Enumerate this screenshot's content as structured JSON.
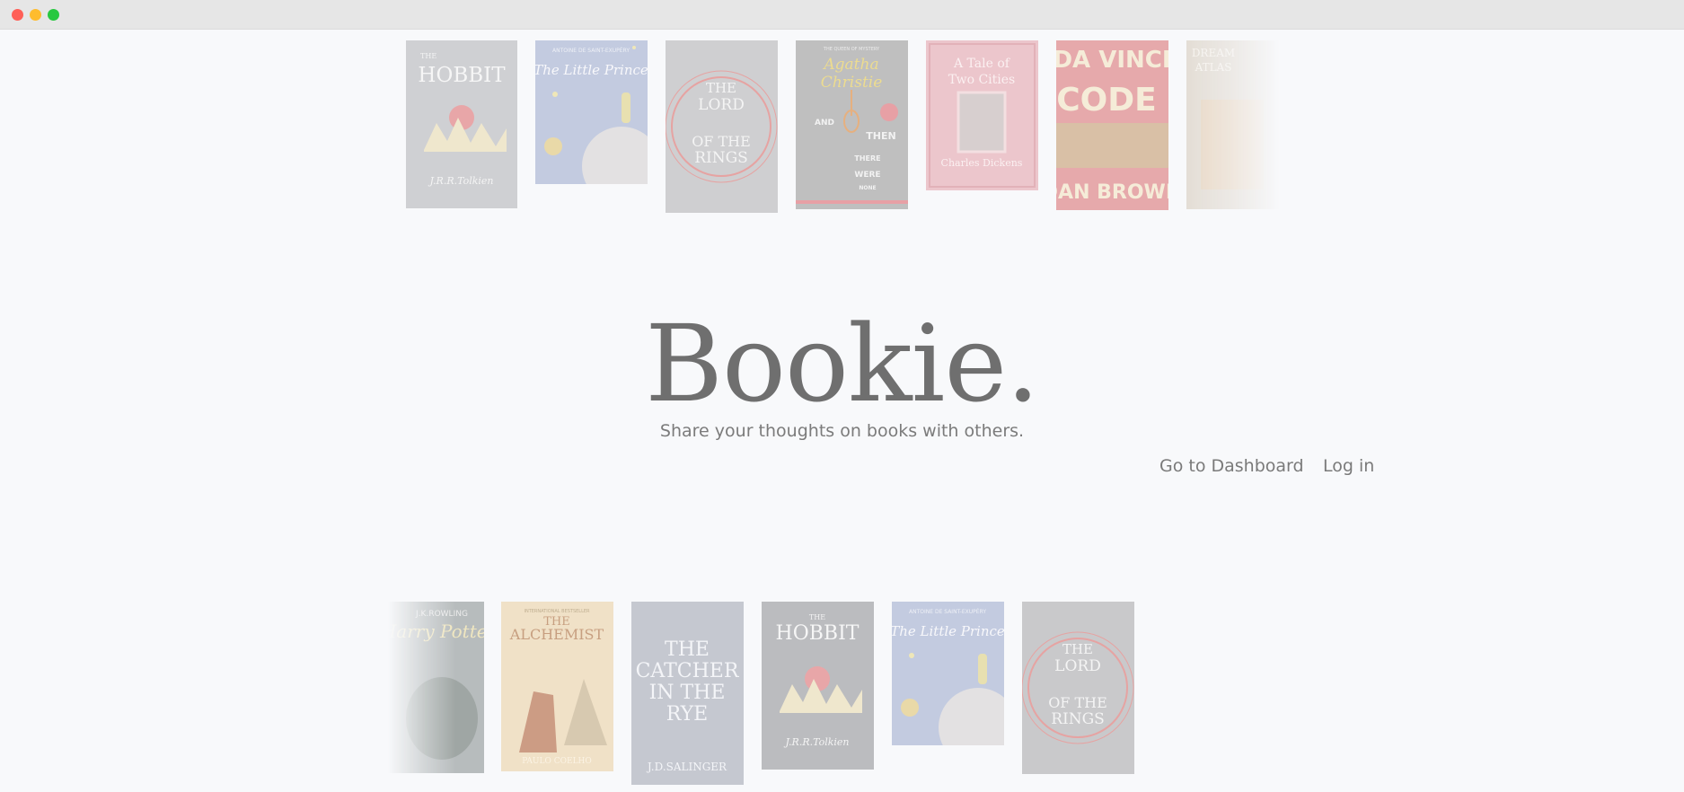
{
  "window": {
    "controls": [
      "close",
      "minimize",
      "maximize"
    ]
  },
  "hero": {
    "title": "Bookie.",
    "subtitle": "Share your thoughts on books with others."
  },
  "nav": {
    "dashboard_label": "Go to Dashboard",
    "login_label": "Log in"
  },
  "covers": {
    "hobbit": {
      "top": "THE",
      "title": "HOBBIT",
      "author": "J.R.R.Tolkien"
    },
    "little_prince": {
      "top": "ANTOINE DE SAINT-EXUPÉRY",
      "title": "The Little Prince"
    },
    "lotr": {
      "line1": "THE",
      "line2": "LORD",
      "line3": "OF THE",
      "line4": "RINGS"
    },
    "christie": {
      "top": "THE QUEEN OF MYSTERY",
      "author1": "Agatha",
      "author2": "Christie",
      "and": "AND",
      "then": "THEN",
      "there": "THERE",
      "were": "WERE",
      "none": "NONE"
    },
    "tale": {
      "line1": "A Tale of",
      "line2": "Two Cities",
      "author": "Charles Dickens"
    },
    "davinci": {
      "line1": "DA VINCI",
      "line2": "CODE",
      "author": "DAN BROWN"
    },
    "partial_top": {
      "line1": "DREAM",
      "line2": "ATLAS"
    },
    "harry_potter": {
      "top": "J.K.ROWLING",
      "title": "Harry Potter"
    },
    "alchemist": {
      "top": "INTERNATIONAL BESTSELLER",
      "title1": "THE",
      "title2": "ALCHEMIST",
      "author": "PAULO COELHO"
    },
    "catcher": {
      "line1": "THE",
      "line2": "CATCHER",
      "line3": "IN THE",
      "line4": "RYE",
      "author": "J.D.SALINGER"
    }
  },
  "colors": {
    "background": "#f8f9fb",
    "title_text": "#6f6f6f",
    "link_text": "#7a7a7a"
  }
}
